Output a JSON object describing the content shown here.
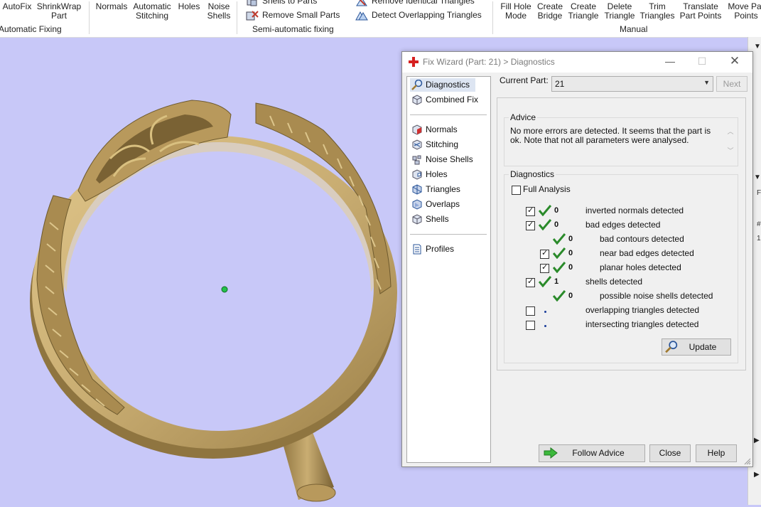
{
  "ribbon": {
    "autofix_group": {
      "buttons": [
        {
          "line1": "AutoFix",
          "line2": ""
        },
        {
          "line1": "ShrinkWrap",
          "line2": "Part"
        }
      ],
      "label": "Automatic Fixing"
    },
    "semiauto_group": {
      "buttons": [
        {
          "line1": "Normals",
          "line2": ""
        },
        {
          "line1": "Automatic",
          "line2": "Stitching"
        },
        {
          "line1": "Holes",
          "line2": ""
        },
        {
          "line1": "Noise",
          "line2": "Shells"
        }
      ],
      "small_col1": [
        "Shells to Parts",
        "Remove Small Parts"
      ],
      "small_col2": [
        "Remove Identical Triangles",
        "Detect Overlapping Triangles"
      ],
      "label": "Semi-automatic fixing"
    },
    "manual_group": {
      "buttons": [
        {
          "line1": "Fill Hole",
          "line2": "Mode"
        },
        {
          "line1": "Create",
          "line2": "Bridge"
        },
        {
          "line1": "Create",
          "line2": "Triangle"
        },
        {
          "line1": "Delete",
          "line2": "Triangle"
        },
        {
          "line1": "Trim",
          "line2": "Triangles"
        },
        {
          "line1": "Translate",
          "line2": "Part Points"
        },
        {
          "line1": "Move Par",
          "line2": "Points"
        }
      ],
      "label": "Manual"
    }
  },
  "right_panel": {
    "fragments": [
      "F",
      "#",
      "1"
    ]
  },
  "dialog": {
    "title": "Fix Wizard (Part: 21) > Diagnostics",
    "nav": {
      "group1": [
        {
          "label": "Diagnostics",
          "icon": "magnifier-icon",
          "selected": true
        },
        {
          "label": "Combined Fix",
          "icon": "cube-icon",
          "selected": false
        }
      ],
      "group2": [
        {
          "label": "Normals",
          "icon": "normals-cube-icon"
        },
        {
          "label": "Stitching",
          "icon": "stitching-cube-icon"
        },
        {
          "label": "Noise Shells",
          "icon": "noise-shells-icon"
        },
        {
          "label": "Holes",
          "icon": "holes-cube-icon"
        },
        {
          "label": "Triangles",
          "icon": "triangles-icon"
        },
        {
          "label": "Overlaps",
          "icon": "overlaps-icon"
        },
        {
          "label": "Shells",
          "icon": "shells-icon"
        }
      ],
      "group3": [
        {
          "label": "Profiles",
          "icon": "document-icon"
        }
      ]
    },
    "current_part_label": "Current Part:",
    "current_part_value": "21",
    "next_label": "Next",
    "advice_title": "Advice",
    "advice_text": "No more errors are detected. It seems that the part is ok. Note that not all parameters were analysed.",
    "diagnostics_title": "Diagnostics",
    "full_analysis_label": "Full Analysis",
    "full_analysis_checked": false,
    "rows": [
      {
        "checkbox": true,
        "checked": true,
        "status": "ok",
        "count": "0",
        "label": "inverted normals detected",
        "indent": 0
      },
      {
        "checkbox": true,
        "checked": true,
        "status": "ok",
        "count": "0",
        "label": "bad edges detected",
        "indent": 0
      },
      {
        "checkbox": false,
        "checked": false,
        "status": "ok",
        "count": "0",
        "label": "bad contours detected",
        "indent": 1
      },
      {
        "checkbox": true,
        "checked": true,
        "status": "ok",
        "count": "0",
        "label": "near bad edges detected",
        "indent": 1
      },
      {
        "checkbox": true,
        "checked": true,
        "status": "ok",
        "count": "0",
        "label": "planar holes detected",
        "indent": 1
      },
      {
        "checkbox": true,
        "checked": true,
        "status": "ok",
        "count": "1",
        "label": "shells detected",
        "indent": 0
      },
      {
        "checkbox": false,
        "checked": false,
        "status": "ok",
        "count": "0",
        "label": "possible noise shells detected",
        "indent": 1
      },
      {
        "checkbox": true,
        "checked": false,
        "status": "pending",
        "count": "",
        "label": "overlapping triangles detected",
        "indent": 0
      },
      {
        "checkbox": true,
        "checked": false,
        "status": "pending",
        "count": "",
        "label": "intersecting triangles detected",
        "indent": 0
      }
    ],
    "update_label": "Update",
    "follow_advice_label": "Follow Advice",
    "close_label": "Close",
    "help_label": "Help"
  },
  "colors": {
    "viewport_bg": "#c8c8f8",
    "part_gold": "#c9ad72",
    "ok_green": "#2a8a2a"
  }
}
